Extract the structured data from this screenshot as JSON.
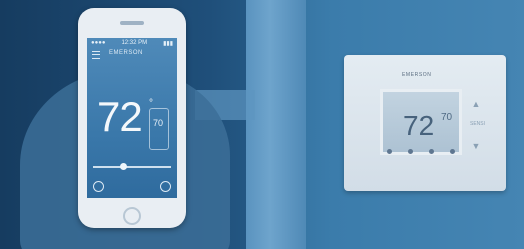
{
  "phone": {
    "status_left": "●●●●",
    "status_time": "12:32 PM",
    "status_right": "▮▮▮",
    "brand": "EMERSON",
    "temperature": "72",
    "degree_symbol": "°",
    "setpoint": "70",
    "slider_value_percent": 38
  },
  "thermostat": {
    "brand": "EMERSON",
    "temperature": "72",
    "setpoint": "70",
    "up_arrow": "▲",
    "down_arrow": "▼",
    "mode_label": "SENSI"
  }
}
